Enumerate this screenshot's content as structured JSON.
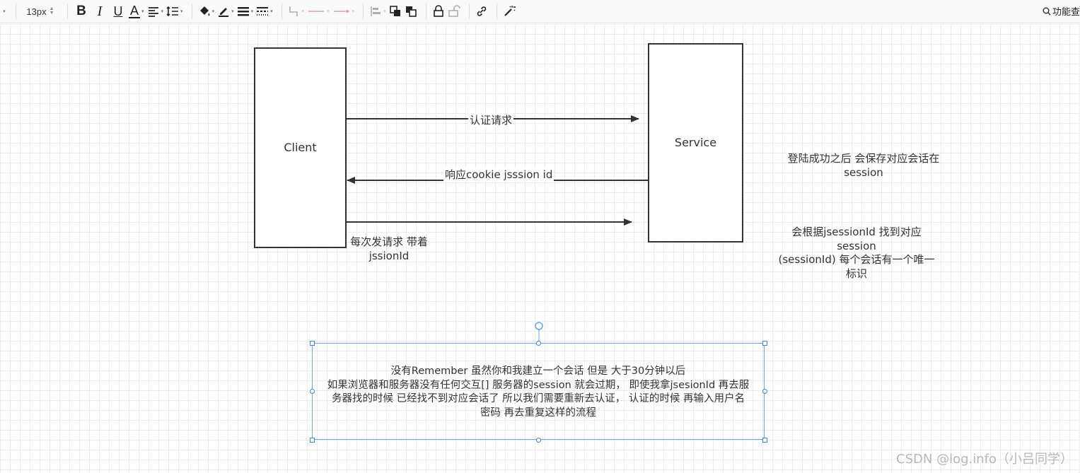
{
  "toolbar": {
    "font_size": "13px",
    "bold": "B",
    "italic": "I",
    "underline": "U",
    "font_color": "A",
    "search_label": "功能查"
  },
  "diagram": {
    "client_label": "Client",
    "service_label": "Service",
    "arrow_auth_label": "认证请求",
    "arrow_response_label": "响应cookie jsssion id",
    "per_request_label_1": "每次发请求 带着",
    "per_request_label_2": "jssionId",
    "note_login_1": "登陆成功之后 会保存对应会话在",
    "note_login_2": "session",
    "note_find_1": "会根据jsessionId 找到对应",
    "note_find_2": "session",
    "note_find_3": "(sessionId) 每个会话有一个唯一",
    "note_find_4": "标识",
    "selected_text_1": "没有Remember  虽然你和我建立一个会话 但是 大于30分钟以后",
    "selected_text_2": "如果浏览器和服务器没有任何交互[] 服务器的session 就会过期， 即使我拿jsesionId 再去服",
    "selected_text_3": "务器找的时候  已经找不到对应会话了  所以我们需要重新去认证，  认证的时候 再输入用户名",
    "selected_text_4": "密码 再去重复这样的流程"
  },
  "watermark": "CSDN @log.info（小吕同学）",
  "colors": {
    "selection": "#6aa5e8",
    "grid": "#ececec",
    "stroke": "#333333"
  }
}
